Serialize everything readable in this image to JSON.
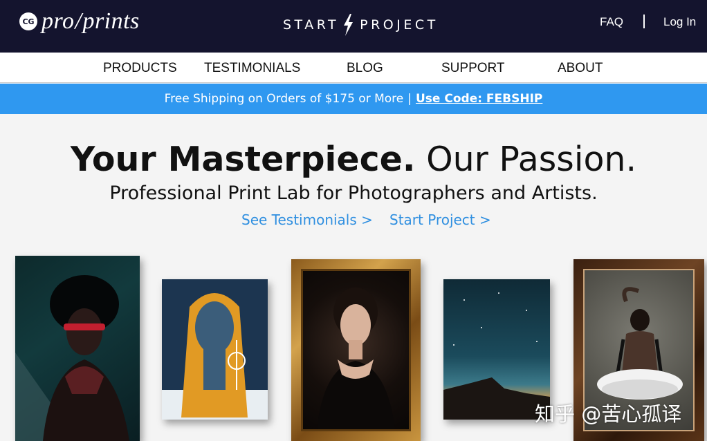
{
  "header": {
    "logo_badge": "CG",
    "logo_text_left": "pro",
    "logo_text_sep": "/",
    "logo_text_right": "prints",
    "start_left": "START",
    "start_right": "PROJECT",
    "faq": "FAQ",
    "login": "Log In"
  },
  "nav": {
    "items": [
      "PRODUCTS",
      "TESTIMONIALS",
      "BLOG",
      "SUPPORT",
      "ABOUT"
    ]
  },
  "promo": {
    "text": "Free Shipping on Orders of $175 or More",
    "separator": "|",
    "code_label": "Use Code: FEBSHIP"
  },
  "hero": {
    "headline_bold": "Your Masterpiece.",
    "headline_light": "Our Passion.",
    "subhead": "Professional Print Lab for Photographers and Artists.",
    "link_testimonials": "See Testimonials >",
    "link_start": "Start Project >"
  },
  "gallery": {
    "items": [
      "portrait-photo",
      "illustration-print",
      "framed-portrait",
      "landscape-print",
      "framed-ballet-photo"
    ]
  },
  "watermark": "知乎 @苦心孤译",
  "colors": {
    "topbar": "#14142e",
    "promo": "#2f98f0",
    "link": "#2f8fe0",
    "background": "#f4f4f4"
  }
}
